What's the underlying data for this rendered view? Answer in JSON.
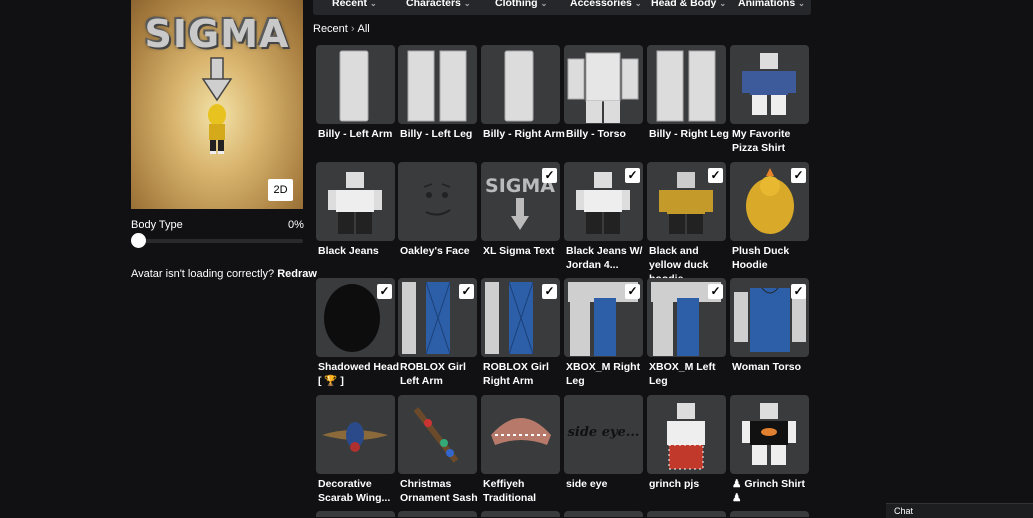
{
  "nav": {
    "tabs": [
      {
        "label": "Recent"
      },
      {
        "label": "Characters"
      },
      {
        "label": "Clothing"
      },
      {
        "label": "Accessories"
      },
      {
        "label": "Head & Body"
      },
      {
        "label": "Animations"
      }
    ]
  },
  "preview": {
    "sign_text": "SIGMA",
    "toggle_label": "2D"
  },
  "body_type": {
    "label": "Body Type",
    "value": "0%",
    "level": 0
  },
  "redraw": {
    "message": "Avatar isn't loading correctly?",
    "link": "Redraw"
  },
  "breadcrumb": {
    "root": "Recent",
    "current": "All"
  },
  "items": [
    {
      "name": "Billy - Left Arm",
      "equipped": false,
      "icon": "limb-arm-icon"
    },
    {
      "name": "Billy - Left Leg",
      "equipped": false,
      "icon": "limb-legs-icon"
    },
    {
      "name": "Billy - Right Arm",
      "equipped": false,
      "icon": "limb-arm-icon"
    },
    {
      "name": "Billy - Torso",
      "equipped": false,
      "icon": "torso-icon"
    },
    {
      "name": "Billy - Right Leg",
      "equipped": false,
      "icon": "limb-legs-icon"
    },
    {
      "name": "My Favorite Pizza Shirt",
      "equipped": false,
      "icon": "shirt-avatar-icon"
    },
    {
      "name": "Black Jeans",
      "equipped": false,
      "icon": "pants-avatar-icon"
    },
    {
      "name": "Oakley's Face",
      "equipped": false,
      "icon": "face-icon"
    },
    {
      "name": "XL Sigma Text",
      "equipped": true,
      "icon": "sigma-text-icon"
    },
    {
      "name": "Black Jeans W/ Jordan 4...",
      "equipped": true,
      "icon": "pants-avatar-icon"
    },
    {
      "name": "Black and yellow duck hoodie",
      "equipped": true,
      "icon": "hoodie-avatar-icon"
    },
    {
      "name": "Plush Duck Hoodie",
      "equipped": true,
      "icon": "duck-hood-icon"
    },
    {
      "name": "Shadowed Head [ 🏆 ]",
      "equipped": true,
      "icon": "shadow-head-icon"
    },
    {
      "name": "ROBLOX Girl Left Arm",
      "equipped": true,
      "icon": "blue-arm-icon"
    },
    {
      "name": "ROBLOX Girl Right Arm",
      "equipped": true,
      "icon": "blue-arm-icon"
    },
    {
      "name": "XBOX_M Right Leg",
      "equipped": true,
      "icon": "blue-leg-icon"
    },
    {
      "name": "XBOX_M Left Leg",
      "equipped": true,
      "icon": "blue-leg-icon"
    },
    {
      "name": "Woman Torso",
      "equipped": true,
      "icon": "blue-torso-icon"
    },
    {
      "name": "Decorative Scarab Wing...",
      "equipped": false,
      "icon": "scarab-icon"
    },
    {
      "name": "Christmas Ornament Sash",
      "equipped": false,
      "icon": "sash-icon"
    },
    {
      "name": "Keffiyeh Traditional",
      "equipped": false,
      "icon": "keffiyeh-icon"
    },
    {
      "name": "side eye",
      "equipped": false,
      "icon": "side-eye-icon",
      "thumb_text": "side eye..."
    },
    {
      "name": "grinch pjs",
      "equipped": false,
      "icon": "pajama-avatar-icon"
    },
    {
      "name": "♟ Grinch Shirt ♟",
      "equipped": false,
      "icon": "grinch-shirt-icon"
    }
  ],
  "chat": {
    "label": "Chat"
  },
  "colors": {
    "background": "#111113",
    "tile": "#393b3d",
    "nav": "#26272b"
  }
}
